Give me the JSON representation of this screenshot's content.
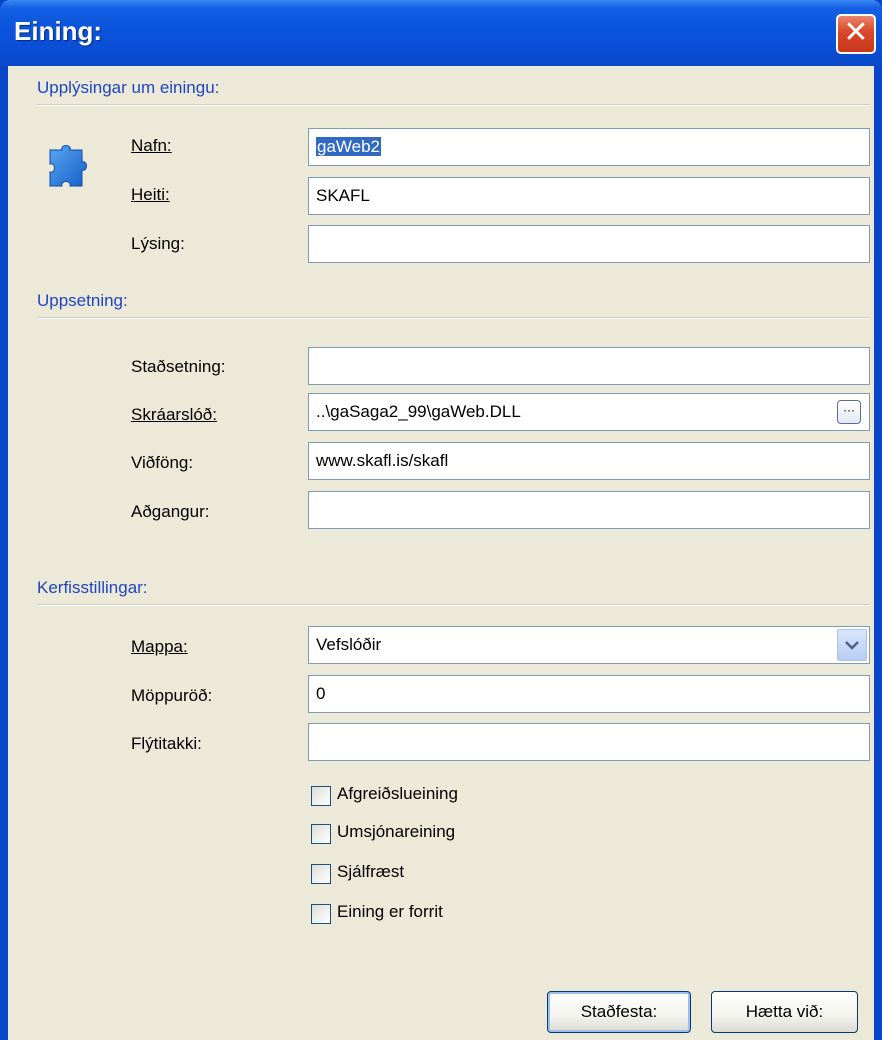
{
  "window": {
    "title": "Eining:",
    "close_glyph": "✕"
  },
  "sections": {
    "info": "Upplýsingar um einingu:",
    "setup": "Uppsetning:",
    "system": "Kerfisstillingar:"
  },
  "info": {
    "name_label": "Nafn:",
    "name_value": "gaWeb2",
    "title_label": "Heiti:",
    "title_value": "SKAFL",
    "desc_label": "Lýsing:",
    "desc_value": ""
  },
  "setup": {
    "location_label": "Staðsetning:",
    "location_value": "",
    "filepath_label": "Skráarslóð:",
    "filepath_value": "..\\gaSaga2_99\\gaWeb.DLL",
    "browse_label": "···",
    "address_label": "Viðföng:",
    "address_value": "www.skafl.is/skafl",
    "access_label": "Aðgangur:",
    "access_value": ""
  },
  "system": {
    "folder_label": "Mappa:",
    "folder_value": "Vefslóðir",
    "folder_order_label": "Möppuröð:",
    "folder_order_value": "0",
    "shortcut_label": "Flýtitakki:",
    "shortcut_value": "",
    "checkboxes": [
      {
        "label": "Afgreiðslueining",
        "checked": false
      },
      {
        "label": "Umsjónareining",
        "checked": false
      },
      {
        "label": "Sjálfræst",
        "checked": false
      },
      {
        "label": "Eining er forrit",
        "checked": false
      }
    ]
  },
  "buttons": {
    "confirm": "Staðfesta:",
    "cancel": "Hætta við:"
  },
  "colors": {
    "titlebar": "#0a4fd6",
    "section_title": "#1f46c2",
    "window_bg": "#ece9d8",
    "selection": "#316ac5"
  },
  "icons": {
    "module": "puzzle-piece-icon",
    "close": "close-icon",
    "dropdown": "chevron-down-icon",
    "browse": "ellipsis-icon"
  }
}
